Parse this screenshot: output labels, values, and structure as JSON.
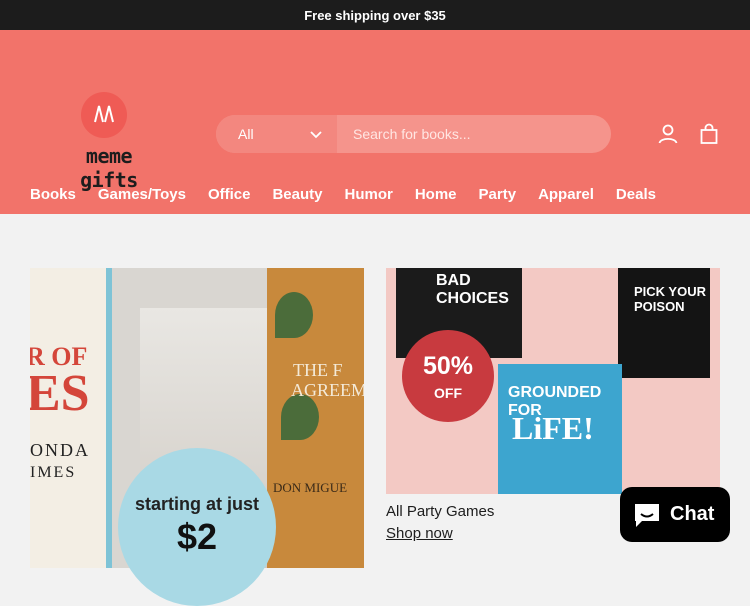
{
  "announcement": "Free shipping over $35",
  "brand": {
    "name": "meme gifts",
    "accent": "#f2736a"
  },
  "search": {
    "category": "All",
    "placeholder": "Search for books..."
  },
  "nav": [
    "Books",
    "Games/Toys",
    "Office",
    "Beauty",
    "Humor",
    "Home",
    "Party",
    "Apparel",
    "Deals"
  ],
  "promo1": {
    "badge_line1": "starting at just",
    "badge_price": "$2",
    "book_left_line1": "R OF",
    "book_left_line2": "ES",
    "book_left_line3": "ONDA",
    "book_left_line4": "IMES",
    "book_right_line1": "THE F",
    "book_right_line2": "AGREEM",
    "book_right_line3": "DON MIGUE"
  },
  "promo2": {
    "box1": "BAD CHOICES",
    "box2": "PICK YOUR POISON",
    "box3_line1": "GROUNDED FOR",
    "box3_line2": "LiFE!",
    "discount": "50%",
    "discount_label": "OFF",
    "title": "All Party Games",
    "link": "Shop now"
  },
  "chat": {
    "label": "Chat"
  }
}
